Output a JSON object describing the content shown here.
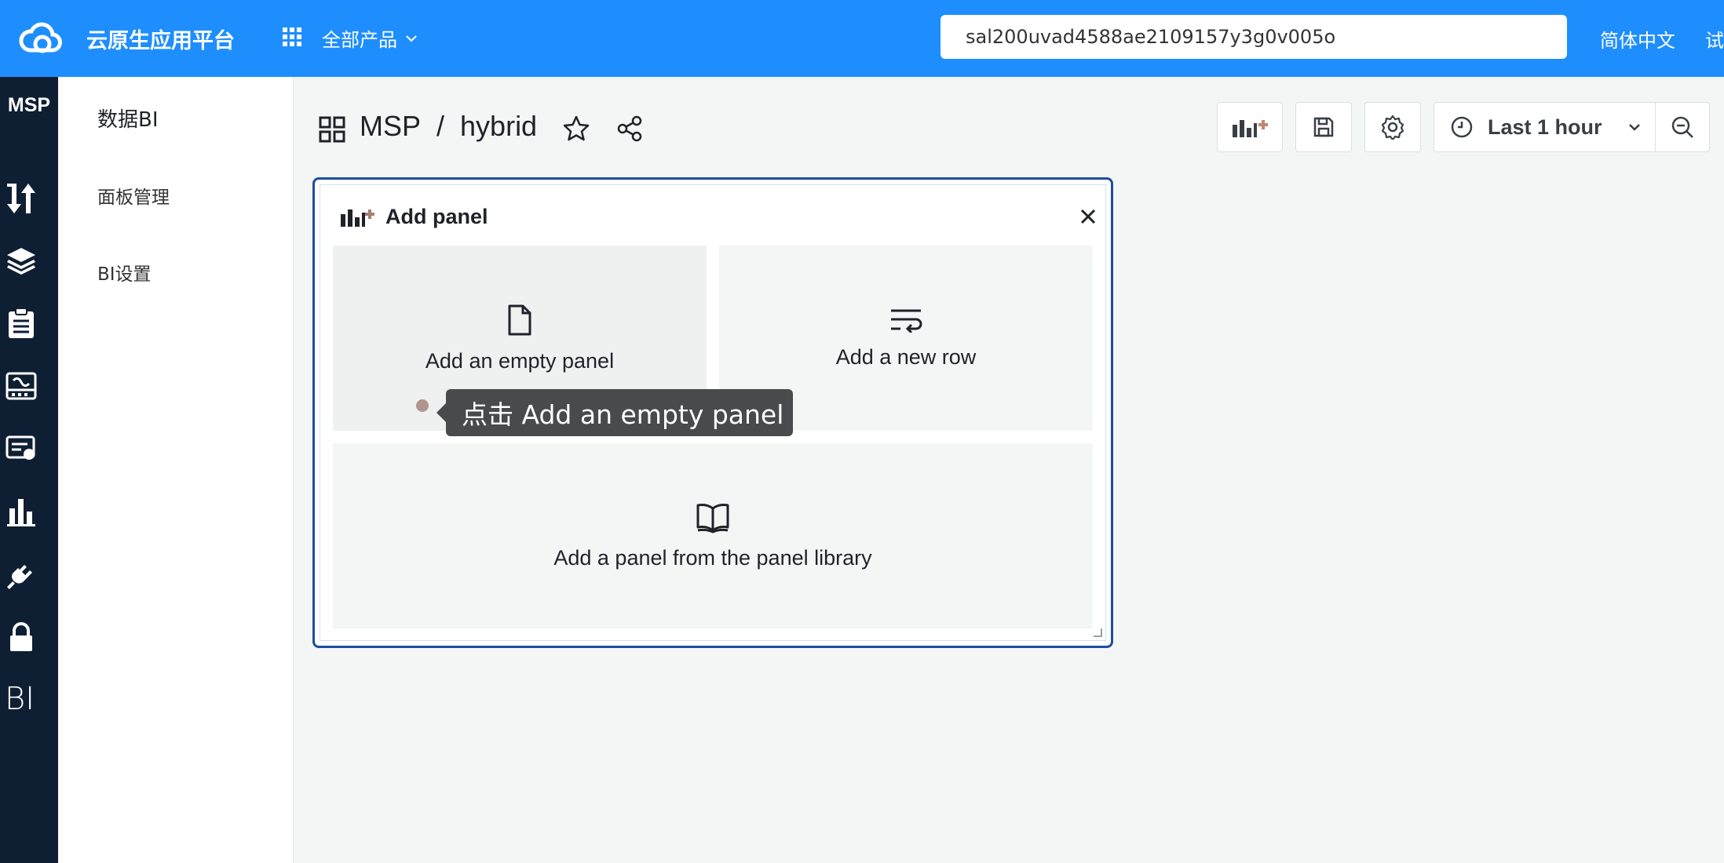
{
  "topbar": {
    "brand": "云原生应用平台",
    "all_products": "全部产品",
    "search_value": "sal200uvad4588ae2109157y3g0v005o",
    "language": "简体中文",
    "trial": "试"
  },
  "rail": {
    "title": "MSP",
    "bi_label": "BI",
    "icons": [
      "sort-icon",
      "layers-icon",
      "clipboard-icon",
      "monitor-icon",
      "certificate-icon",
      "bar-chart-icon",
      "plug-icon",
      "lock-icon"
    ]
  },
  "sidebar": {
    "title": "数据BI",
    "items": [
      {
        "label": "面板管理"
      },
      {
        "label": "BI设置"
      }
    ]
  },
  "dashboard": {
    "breadcrumb_root": "MSP",
    "breadcrumb_sep": "/",
    "breadcrumb_leaf": "hybrid",
    "time_range": "Last 1 hour"
  },
  "add_panel": {
    "title": "Add panel",
    "options": [
      {
        "label": "Add an empty panel",
        "icon": "file-icon"
      },
      {
        "label": "Add a new row",
        "icon": "wrap-lines-icon"
      },
      {
        "label": "Add a panel from the panel library",
        "icon": "book-icon"
      }
    ]
  },
  "tooltip": {
    "text": "点击 Add an empty panel"
  },
  "colors": {
    "topbar": "#1e8eff",
    "rail": "#0f1f33",
    "panel_border": "#1b4fa0"
  }
}
